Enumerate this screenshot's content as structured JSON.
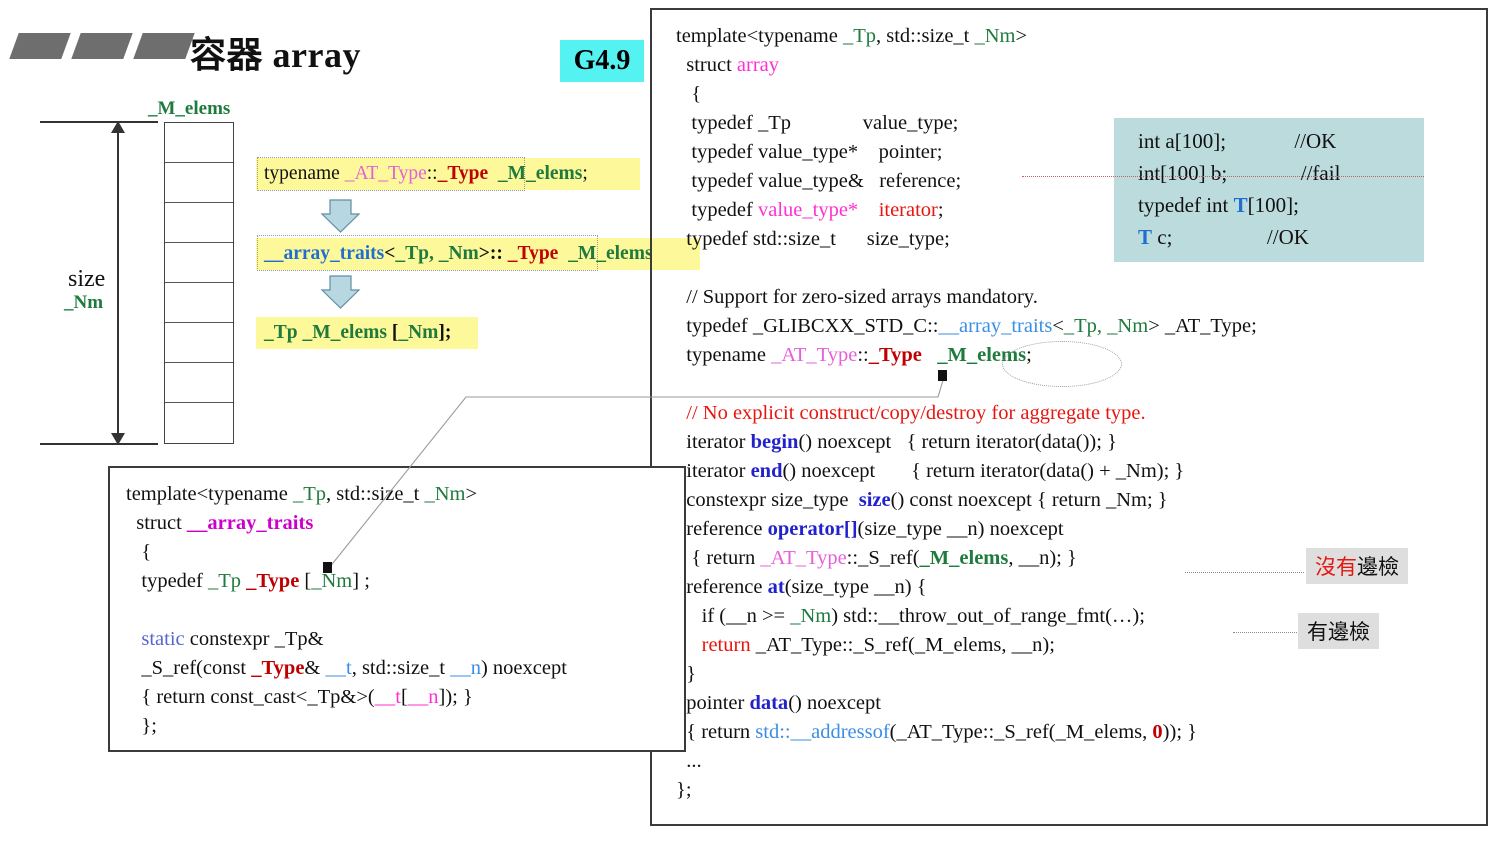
{
  "slide": {
    "title": "容器 array",
    "version_badge": "G4.9",
    "decor_icon": "parallelogram-bars-icon"
  },
  "array_diagram": {
    "member_label": "_M_elems",
    "size_label": "size",
    "size_value_label": "_Nm",
    "cell_count": 8
  },
  "transform_steps": [
    {
      "id": "step1",
      "parts": [
        {
          "t": "typename ",
          "c": "c-black"
        },
        {
          "t": "_AT_Type",
          "c": "c-magenta"
        },
        {
          "t": "::",
          "c": "c-black"
        },
        {
          "t": "_Type",
          "c": "c-red"
        },
        {
          "t": "  ",
          "c": "c-black"
        },
        {
          "t": "_M_elems",
          "c": "c-green"
        },
        {
          "t": ";",
          "c": "c-black"
        }
      ]
    },
    {
      "id": "step2",
      "parts": [
        {
          "t": "__array_traits",
          "c": "c-blue"
        },
        {
          "t": "<",
          "c": "c-black"
        },
        {
          "t": "_Tp, _Nm",
          "c": "c-green"
        },
        {
          "t": ">:: ",
          "c": "c-black"
        },
        {
          "t": "_Type",
          "c": "c-red"
        },
        {
          "t": "  ",
          "c": "c-black"
        },
        {
          "t": "_M_elems",
          "c": "c-green"
        }
      ]
    },
    {
      "id": "step3",
      "parts": [
        {
          "t": "_Tp",
          "c": "c-green"
        },
        {
          "t": " ",
          "c": "c-black"
        },
        {
          "t": "_M_elems",
          "c": "c-green"
        },
        {
          "t": " [",
          "c": "c-black"
        },
        {
          "t": "_Nm",
          "c": "c-green"
        },
        {
          "t": "];",
          "c": "c-black"
        }
      ]
    }
  ],
  "array_source": {
    "lines": [
      [
        {
          "t": "template<typename ",
          "c": "c-black"
        },
        {
          "t": "_Tp",
          "c": "c-green-n"
        },
        {
          "t": ", std::size_t ",
          "c": "c-black"
        },
        {
          "t": "_Nm",
          "c": "c-green-n"
        },
        {
          "t": ">",
          "c": "c-black"
        }
      ],
      [
        {
          "t": "  struct ",
          "c": "c-black"
        },
        {
          "t": "array",
          "c": "c-pink"
        }
      ],
      [
        {
          "t": "   {",
          "c": "c-black"
        }
      ],
      [
        {
          "t": "   typedef _Tp              value_type;",
          "c": "c-black"
        }
      ],
      [
        {
          "t": "   typedef value_type*    pointer;",
          "c": "c-black"
        }
      ],
      [
        {
          "t": "   typedef value_type&   reference;",
          "c": "c-black"
        }
      ],
      [
        {
          "t": "   typedef ",
          "c": "c-black"
        },
        {
          "t": "value_type*",
          "c": "c-pink"
        },
        {
          "t": "    ",
          "c": "c-black"
        },
        {
          "t": "iterator",
          "c": "c-red-n"
        },
        {
          "t": ";",
          "c": "c-black"
        }
      ],
      [
        {
          "t": "  typedef std::size_t      size_type;",
          "c": "c-black"
        }
      ],
      [
        {
          "t": "",
          "c": "c-black"
        }
      ],
      [
        {
          "t": "  // Support for zero-sized arrays mandatory.",
          "c": "c-black"
        }
      ],
      [
        {
          "t": "  typedef _GLIBCXX_STD_C::",
          "c": "c-black"
        },
        {
          "t": "__array_traits",
          "c": "c-blue-n"
        },
        {
          "t": "<",
          "c": "c-black"
        },
        {
          "t": "_Tp, _Nm",
          "c": "c-green-n"
        },
        {
          "t": "> _AT_Type;",
          "c": "c-black"
        }
      ],
      [
        {
          "t": "  typename ",
          "c": "c-black"
        },
        {
          "t": "_AT_Type",
          "c": "c-magenta"
        },
        {
          "t": "::",
          "c": "c-black"
        },
        {
          "t": "_Type",
          "c": "c-red"
        },
        {
          "t": "   ",
          "c": "c-black"
        },
        {
          "t": "_M_elems",
          "c": "c-green"
        },
        {
          "t": ";",
          "c": "c-black"
        }
      ],
      [
        {
          "t": "",
          "c": "c-black"
        }
      ],
      [
        {
          "t": "  // No explicit construct/copy/destroy for aggregate type.",
          "c": "c-red-n"
        }
      ],
      [
        {
          "t": "  iterator ",
          "c": "c-black"
        },
        {
          "t": "begin",
          "c": "c-navy"
        },
        {
          "t": "() noexcept   { return iterator(data()); }",
          "c": "c-black"
        }
      ],
      [
        {
          "t": "  iterator ",
          "c": "c-black"
        },
        {
          "t": "end",
          "c": "c-navy"
        },
        {
          "t": "() noexcept       { return iterator(data() + _Nm); }",
          "c": "c-black"
        }
      ],
      [
        {
          "t": "  constexpr size_type  ",
          "c": "c-black"
        },
        {
          "t": "size",
          "c": "c-navy"
        },
        {
          "t": "() const noexcept { return _Nm; }",
          "c": "c-black"
        }
      ],
      [
        {
          "t": "  reference ",
          "c": "c-black"
        },
        {
          "t": "operator[]",
          "c": "c-navy"
        },
        {
          "t": "(size_type __n) noexcept",
          "c": "c-black"
        }
      ],
      [
        {
          "t": "   { return ",
          "c": "c-black"
        },
        {
          "t": "_AT_Type",
          "c": "c-magenta"
        },
        {
          "t": "::_S_ref(",
          "c": "c-black"
        },
        {
          "t": "_M_elems",
          "c": "c-green"
        },
        {
          "t": ", __n); }",
          "c": "c-black"
        }
      ],
      [
        {
          "t": "  reference ",
          "c": "c-black"
        },
        {
          "t": "at",
          "c": "c-navy"
        },
        {
          "t": "(size_type __n) {",
          "c": "c-black"
        }
      ],
      [
        {
          "t": "     if (__n >= ",
          "c": "c-black"
        },
        {
          "t": "_Nm",
          "c": "c-green-n"
        },
        {
          "t": ") std::__throw_out_of_range_fmt(…);",
          "c": "c-black"
        }
      ],
      [
        {
          "t": "     ",
          "c": "c-black"
        },
        {
          "t": "return",
          "c": "c-red-n"
        },
        {
          "t": " _AT_Type::_S_ref(_M_elems, __n);",
          "c": "c-black"
        }
      ],
      [
        {
          "t": "  }",
          "c": "c-black"
        }
      ],
      [
        {
          "t": "  pointer ",
          "c": "c-black"
        },
        {
          "t": "data",
          "c": "c-navy"
        },
        {
          "t": "() noexcept",
          "c": "c-black"
        }
      ],
      [
        {
          "t": "  { return ",
          "c": "c-black"
        },
        {
          "t": "std::__addressof",
          "c": "c-blue-n"
        },
        {
          "t": "(_AT_Type::_S_ref(_M_elems, ",
          "c": "c-black"
        },
        {
          "t": "0",
          "c": "c-red"
        },
        {
          "t": ")); }",
          "c": "c-black"
        }
      ],
      [
        {
          "t": "  ...",
          "c": "c-black"
        }
      ],
      [
        {
          "t": "};",
          "c": "c-black"
        }
      ]
    ]
  },
  "decl_example": {
    "rows": [
      [
        {
          "t": "int a[100];",
          "c": "c-black"
        },
        {
          "t": "             ",
          "c": "c-black"
        },
        {
          "t": "//OK",
          "c": "c-black"
        }
      ],
      [
        {
          "t": "int[100] b;",
          "c": "c-black"
        },
        {
          "t": "              ",
          "c": "c-black"
        },
        {
          "t": "//fail",
          "c": "c-black"
        }
      ],
      [
        {
          "t": "typedef int ",
          "c": "c-black"
        },
        {
          "t": "T",
          "c": "c-blue"
        },
        {
          "t": "[100];",
          "c": "c-black"
        }
      ],
      [
        {
          "t": "T",
          "c": "c-blue"
        },
        {
          "t": " c;",
          "c": "c-black"
        },
        {
          "t": "                  ",
          "c": "c-black"
        },
        {
          "t": "//OK",
          "c": "c-black"
        }
      ]
    ]
  },
  "traits_source": {
    "lines": [
      [
        {
          "t": "template<typename ",
          "c": "c-black"
        },
        {
          "t": "_Tp",
          "c": "c-green-n"
        },
        {
          "t": ", std::size_t ",
          "c": "c-black"
        },
        {
          "t": "_Nm",
          "c": "c-green-n"
        },
        {
          "t": ">",
          "c": "c-black"
        }
      ],
      [
        {
          "t": "  struct ",
          "c": "c-black"
        },
        {
          "t": "__array_traits",
          "c": "c-magenta-b"
        }
      ],
      [
        {
          "t": "   {",
          "c": "c-black"
        }
      ],
      [
        {
          "t": "   typedef ",
          "c": "c-black"
        },
        {
          "t": "_Tp",
          "c": "c-green-n"
        },
        {
          "t": " ",
          "c": "c-black"
        },
        {
          "t": "_Type",
          "c": "c-red"
        },
        {
          "t": " [",
          "c": "c-black"
        },
        {
          "t": "_Nm",
          "c": "c-green-n"
        },
        {
          "t": "] ;",
          "c": "c-black"
        }
      ],
      [
        {
          "t": "",
          "c": "c-black"
        }
      ],
      [
        {
          "t": "   ",
          "c": "c-black"
        },
        {
          "t": "static",
          "c": "c-slate"
        },
        {
          "t": " constexpr _Tp&",
          "c": "c-black"
        }
      ],
      [
        {
          "t": "   _S_ref(const ",
          "c": "c-black"
        },
        {
          "t": "_Type",
          "c": "c-red"
        },
        {
          "t": "& ",
          "c": "c-black"
        },
        {
          "t": "__t",
          "c": "c-blue-n"
        },
        {
          "t": ", std::size_t ",
          "c": "c-black"
        },
        {
          "t": "__n",
          "c": "c-blue-n"
        },
        {
          "t": ") noexcept",
          "c": "c-black"
        }
      ],
      [
        {
          "t": "   { return const_cast<_Tp&>(",
          "c": "c-black"
        },
        {
          "t": "__t",
          "c": "c-pink"
        },
        {
          "t": "[",
          "c": "c-black"
        },
        {
          "t": "__n",
          "c": "c-pink"
        },
        {
          "t": "]); }",
          "c": "c-black"
        }
      ],
      [
        {
          "t": "   };",
          "c": "c-black"
        }
      ]
    ]
  },
  "annotations": {
    "no_bounds_check": {
      "red": "沒有",
      "black": "邊檢"
    },
    "has_bounds_check": {
      "black": "有邊檢"
    }
  },
  "colors": {
    "highlight_yellow": "#fdf89a",
    "badge_cyan": "#55f2f2",
    "example_box": "#bcdbdd",
    "note_badge_gray": "#dedede",
    "green": "#1f7a3d",
    "red": "#c00000",
    "blue": "#1f6fd0",
    "magenta": "#cc00cc"
  }
}
